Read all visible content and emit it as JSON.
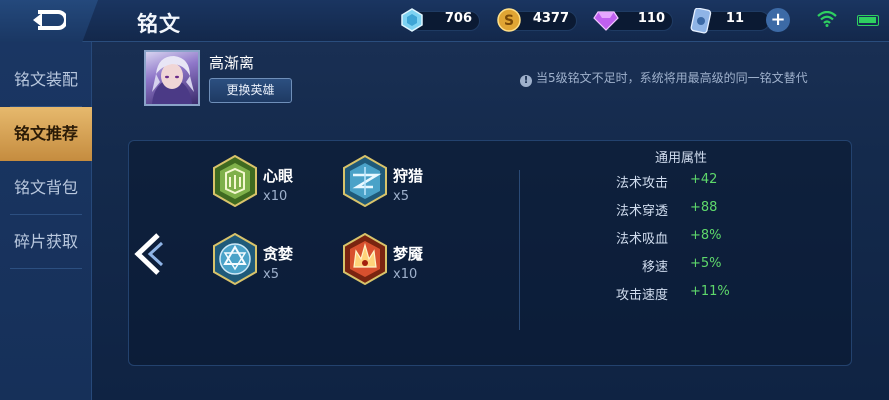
{
  "header": {
    "title": "铭文",
    "currencies": [
      {
        "name": "diamond",
        "value": "706",
        "icon": "diamond-icon"
      },
      {
        "name": "gold",
        "value": "4377",
        "icon": "gold-coin-icon"
      },
      {
        "name": "gem",
        "value": "110",
        "icon": "purple-gem-icon"
      },
      {
        "name": "ticket",
        "value": "11",
        "icon": "card-icon"
      }
    ],
    "plus_label": "+"
  },
  "sidebar": {
    "items": [
      {
        "label": "铭文装配",
        "active": false
      },
      {
        "label": "铭文推荐",
        "active": true
      },
      {
        "label": "铭文背包",
        "active": false
      },
      {
        "label": "碎片获取",
        "active": false
      }
    ]
  },
  "hero": {
    "name": "高渐离",
    "change_button": "更换英雄"
  },
  "notice": {
    "icon": "!",
    "text": "当5级铭文不足时，系统将用最高级的同一铭文替代"
  },
  "runes": [
    {
      "name": "心眼",
      "count": "x10",
      "color": "#7fb04a"
    },
    {
      "name": "狩猎",
      "count": "x5",
      "color": "#4aa2c8"
    },
    {
      "name": "贪婪",
      "count": "x5",
      "color": "#4aa2c8"
    },
    {
      "name": "梦魇",
      "count": "x10",
      "color": "#d8502e"
    }
  ],
  "attributes": {
    "title": "通用属性",
    "rows": [
      {
        "label": "法术攻击",
        "value": "+42"
      },
      {
        "label": "法术穿透",
        "value": "+88"
      },
      {
        "label": "法术吸血",
        "value": "+8%"
      },
      {
        "label": "移速",
        "value": "+5%"
      },
      {
        "label": "攻击速度",
        "value": "+11%"
      }
    ],
    "value_color": "#5ed86b"
  }
}
